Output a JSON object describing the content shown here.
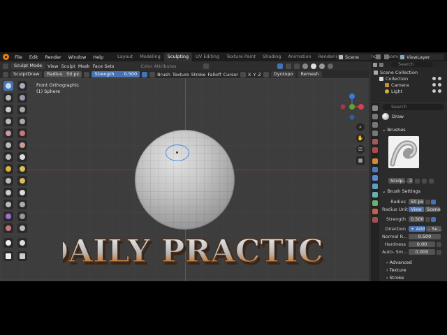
{
  "menubar": {
    "items": [
      "File",
      "Edit",
      "Render",
      "Window",
      "Help"
    ],
    "workspaces": [
      "Layout",
      "Modeling",
      "Sculpting",
      "UV Editing",
      "Texture Paint",
      "Shading",
      "Animation",
      "Rendering",
      "Compositing",
      "Geome"
    ],
    "active_workspace": "Sculpting",
    "scene": "Scene",
    "view_layer": "ViewLayer"
  },
  "viewport_header": {
    "mode": "Sculpt Mode",
    "menus": [
      "View",
      "Sculpt",
      "Mask",
      "Face Sets"
    ],
    "color_attr": "Color Attributes"
  },
  "tool_settings": {
    "tool": "SculptDraw",
    "radius_label": "Radius",
    "radius_value": "50 px",
    "strength_label": "Strength",
    "strength_value": "0.500",
    "menus": [
      "Brush",
      "Texture",
      "Stroke",
      "Falloff",
      "Cursor"
    ],
    "axes": [
      "X",
      "Y",
      "Z"
    ],
    "dyntopo": "Dyntopo",
    "remesh": "Remesh"
  },
  "viewport_info": {
    "view": "Front Orthographic",
    "object": "(1) Sphere"
  },
  "overlay_text": "DAILY PRACTICE",
  "outliner": {
    "search_placeholder": "Search",
    "rows": [
      "Scene Collection",
      "Collection",
      "Camera",
      "Light"
    ]
  },
  "properties": {
    "search_placeholder": "Search",
    "brush_name": "Draw",
    "brushes_header": "Brushes",
    "brush_slot": "Sculp...",
    "brush_users": "2",
    "brush_settings_header": "Brush Settings",
    "radius_label": "Radius",
    "radius_value": "50 px",
    "radius_unit_label": "Radius Unit",
    "radius_unit_view": "View",
    "radius_unit_scene": "Scene",
    "strength_label": "Strength",
    "strength_value": "0.500",
    "direction_label": "Direction",
    "direction_add": "+ Add",
    "direction_sub": "– Su...",
    "normal_radius_label": "Normal R...",
    "normal_radius_value": "0.500",
    "hardness_label": "Hardness",
    "hardness_value": "0.00",
    "auto_smooth_label": "Auto- Sm...",
    "auto_smooth_value": "0.000",
    "subpanels": [
      "Advanced",
      "Texture",
      "Stroke"
    ]
  },
  "colors": {
    "accent": "#4772b3",
    "axis_x": "#d8414f",
    "axis_y": "#66a22b",
    "axis_z": "#3b7bd6",
    "blender_orange": "#e87d0d"
  }
}
